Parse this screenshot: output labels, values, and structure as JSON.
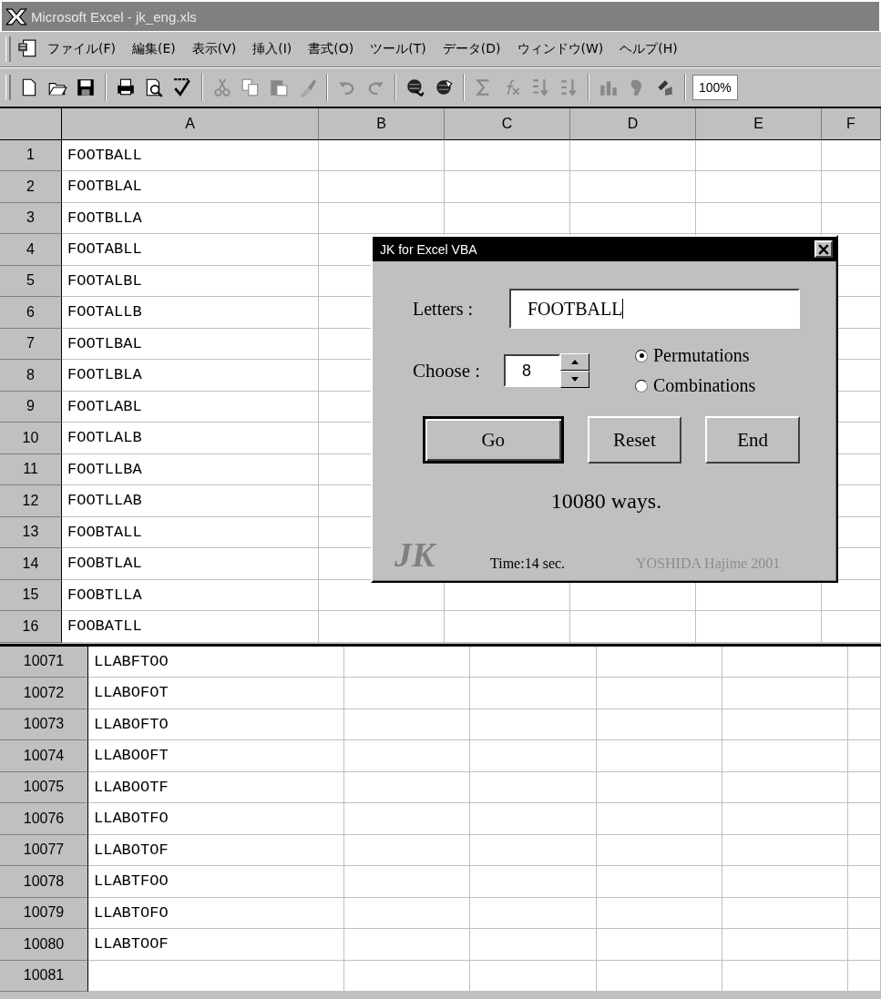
{
  "window": {
    "title": "Microsoft Excel - jk_eng.xls"
  },
  "menu": [
    "ファイル(F)",
    "編集(E)",
    "表示(V)",
    "挿入(I)",
    "書式(O)",
    "ツール(T)",
    "データ(D)",
    "ウィンドウ(W)",
    "ヘルプ(H)"
  ],
  "toolbar": {
    "zoom": "100%"
  },
  "columns": [
    "A",
    "B",
    "C",
    "D",
    "E",
    "F"
  ],
  "top_rows": [
    {
      "number": "1",
      "value": "FOOTBALL"
    },
    {
      "number": "2",
      "value": "FOOTBLAL"
    },
    {
      "number": "3",
      "value": "FOOTBLLA"
    },
    {
      "number": "4",
      "value": "FOOTABLL"
    },
    {
      "number": "5",
      "value": "FOOTALBL"
    },
    {
      "number": "6",
      "value": "FOOTALLB"
    },
    {
      "number": "7",
      "value": "FOOTLBAL"
    },
    {
      "number": "8",
      "value": "FOOTLBLA"
    },
    {
      "number": "9",
      "value": "FOOTLABL"
    },
    {
      "number": "10",
      "value": "FOOTLALB"
    },
    {
      "number": "11",
      "value": "FOOTLLBA"
    },
    {
      "number": "12",
      "value": "FOOTLLAB"
    },
    {
      "number": "13",
      "value": "FOOBTALL"
    },
    {
      "number": "14",
      "value": "FOOBTLAL"
    },
    {
      "number": "15",
      "value": "FOOBTLLA"
    },
    {
      "number": "16",
      "value": "FOOBATLL"
    }
  ],
  "bottom_rows": [
    {
      "number": "10071",
      "value": "LLABFTOO"
    },
    {
      "number": "10072",
      "value": "LLABOFOT"
    },
    {
      "number": "10073",
      "value": "LLABOFTO"
    },
    {
      "number": "10074",
      "value": "LLABOOFT"
    },
    {
      "number": "10075",
      "value": "LLABOOTF"
    },
    {
      "number": "10076",
      "value": "LLABOTFO"
    },
    {
      "number": "10077",
      "value": "LLABOTOF"
    },
    {
      "number": "10078",
      "value": "LLABTFOO"
    },
    {
      "number": "10079",
      "value": "LLABTOFO"
    },
    {
      "number": "10080",
      "value": "LLABTOOF"
    },
    {
      "number": "10081",
      "value": ""
    }
  ],
  "dialog": {
    "title": "JK for Excel VBA",
    "letters_label": "Letters :",
    "letters_value": "FOOTBALL",
    "choose_label": "Choose :",
    "choose_value": "8",
    "options": [
      {
        "label": "Permutations",
        "selected": true
      },
      {
        "label": "Combinations",
        "selected": false
      }
    ],
    "buttons": [
      {
        "label": "Go",
        "default": true
      },
      {
        "label": "Reset",
        "default": false
      },
      {
        "label": "End",
        "default": false
      }
    ],
    "result": "10080 ways.",
    "logo": "JK",
    "time": "Time:14 sec.",
    "credit": "YOSHIDA Hajime 2001"
  }
}
